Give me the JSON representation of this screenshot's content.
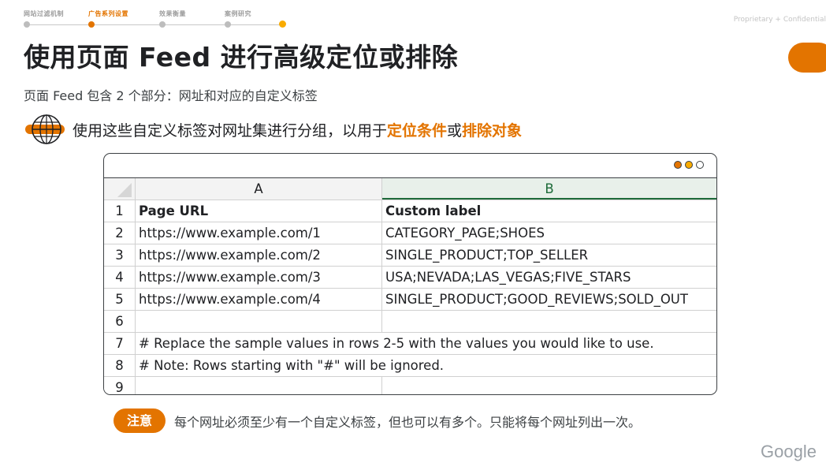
{
  "nav": {
    "steps": [
      {
        "label": "网站过滤机制",
        "active": false
      },
      {
        "label": "广告系列设置",
        "active": true
      },
      {
        "label": "效果衡量",
        "active": false
      },
      {
        "label": "案例研究",
        "active": false
      }
    ]
  },
  "confidential": "Proprietary + Confidential",
  "title": "使用页面 Feed 进行高级定位或排除",
  "subtitle": "页面 Feed 包含 2 个部分：网址和对应的自定义标签",
  "bullet": {
    "icon": "globe-target-icon",
    "text_before": "使用这些自定义标签对网址集进行分组，以用于",
    "highlight1": "定位条件",
    "text_middle": "或",
    "highlight2": "排除对象"
  },
  "window": {
    "dots": [
      "#e37400",
      "#f9ab00",
      "#ffffff"
    ],
    "columns": [
      "A",
      "B"
    ],
    "rows": [
      {
        "num": "1",
        "a": "Page URL",
        "b": "Custom label"
      },
      {
        "num": "2",
        "a": "https://www.example.com/1",
        "b": "CATEGORY_PAGE;SHOES"
      },
      {
        "num": "3",
        "a": "https://www.example.com/2",
        "b": "SINGLE_PRODUCT;TOP_SELLER"
      },
      {
        "num": "4",
        "a": "https://www.example.com/3",
        "b": "USA;NEVADA;LAS_VEGAS;FIVE_STARS"
      },
      {
        "num": "5",
        "a": "https://www.example.com/4",
        "b": "SINGLE_PRODUCT;GOOD_REVIEWS;SOLD_OUT"
      },
      {
        "num": "6",
        "a": "",
        "b": ""
      }
    ],
    "comment_rows": [
      {
        "num": "7",
        "text": "# Replace the sample values in rows 2-5 with the values you would like to use."
      },
      {
        "num": "8",
        "text": "# Note: Rows starting with \"#\" will be ignored."
      }
    ],
    "empty_row": {
      "num": "9"
    }
  },
  "note": {
    "badge": "注意",
    "text": "每个网址必须至少有一个自定义标签，但也可以有多个。只能将每个网址列出一次。"
  },
  "footer_logo": "Google",
  "colors": {
    "accent": "#e37400",
    "accent_light": "#f9ab00",
    "sheet_green": "#1e6b3a"
  }
}
